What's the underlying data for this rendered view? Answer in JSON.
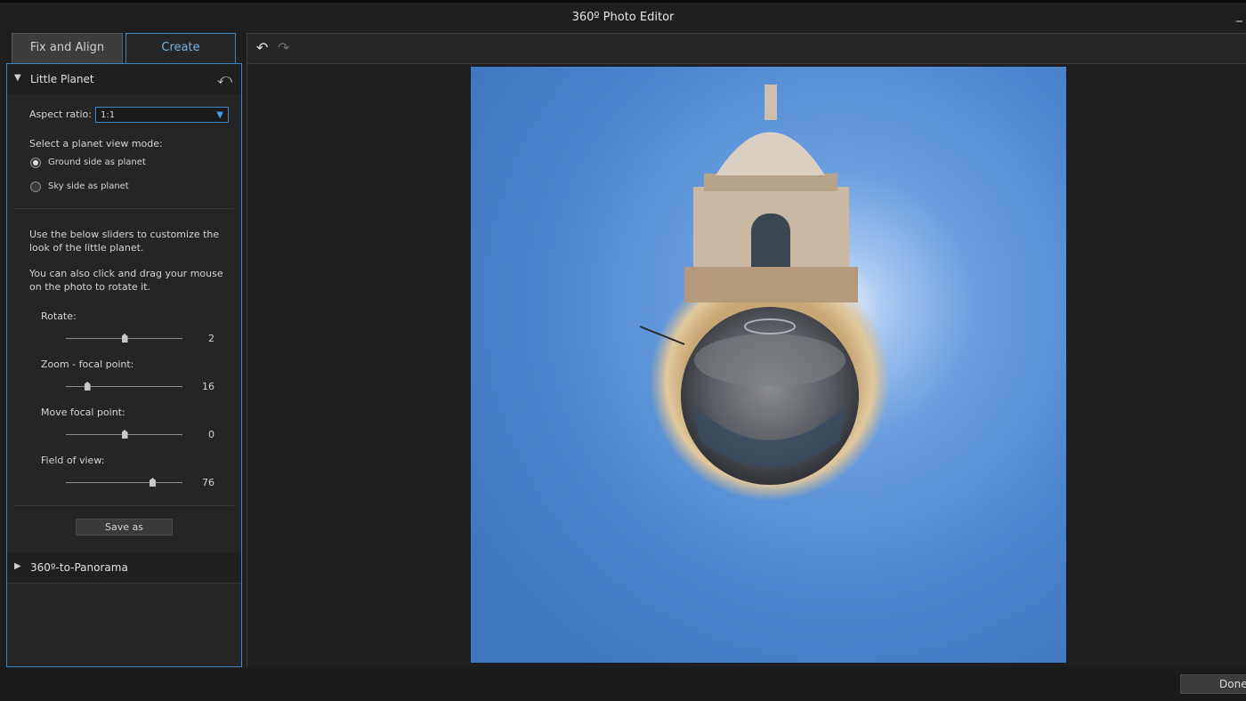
{
  "window": {
    "title": "360º Photo Editor",
    "minimize_glyph": "_"
  },
  "tabs": [
    {
      "label": "Fix and Align",
      "active": false
    },
    {
      "label": "Create",
      "active": true
    }
  ],
  "little_planet": {
    "title": "Little Planet",
    "expanded": true,
    "aspect_ratio_label": "Aspect ratio:",
    "aspect_ratio_value": "1:1",
    "view_mode_prompt": "Select a planet view mode:",
    "view_modes": [
      {
        "label": "Ground side as planet",
        "selected": true
      },
      {
        "label": "Sky side as planet",
        "selected": false
      }
    ],
    "help_text_1": "Use the below sliders to customize the look of the little planet.",
    "help_text_2": "You can also click and drag your mouse on the photo to rotate it.",
    "sliders": [
      {
        "label": "Rotate:",
        "value": "2",
        "level": 0.5
      },
      {
        "label": "Zoom - focal point:",
        "value": "16",
        "level": 0.18
      },
      {
        "label": "Move focal point:",
        "value": "0",
        "level": 0.5
      },
      {
        "label": "Field of view:",
        "value": "76",
        "level": 0.74
      }
    ],
    "save_label": "Save as"
  },
  "panorama_section": {
    "title": "360º-to-Panorama",
    "expanded": false
  },
  "toolbar": {
    "undo_icon": "undo-icon",
    "redo_icon": "redo-icon"
  },
  "footer": {
    "done_label": "Done"
  },
  "colors": {
    "accent": "#3e86c4",
    "sky": "#4a86d0"
  }
}
